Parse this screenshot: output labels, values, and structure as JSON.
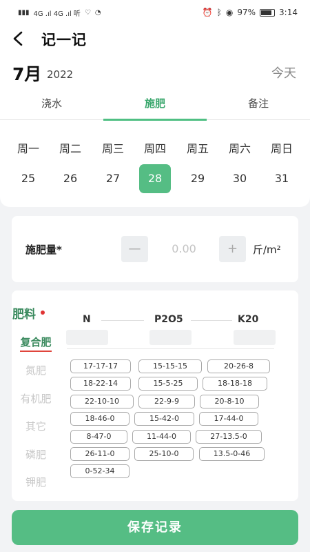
{
  "status_bar": {
    "left_text": "4G .ıl 4G .ıl  听",
    "battery": "97%",
    "time": "3:14"
  },
  "nav": {
    "title": "记一记"
  },
  "date_header": {
    "month": "7月",
    "year": "2022",
    "today": "今天"
  },
  "tabs": [
    {
      "label": "浇水",
      "active": false
    },
    {
      "label": "施肥",
      "active": true
    },
    {
      "label": "备注",
      "active": false
    }
  ],
  "week": [
    {
      "weekday": "周一",
      "day": "25"
    },
    {
      "weekday": "周二",
      "day": "26"
    },
    {
      "weekday": "周三",
      "day": "27"
    },
    {
      "weekday": "周四",
      "day": "28",
      "selected": true
    },
    {
      "weekday": "周五",
      "day": "29"
    },
    {
      "weekday": "周六",
      "day": "30"
    },
    {
      "weekday": "周日",
      "day": "31"
    }
  ],
  "amount": {
    "label": "施肥量*",
    "minus": "—",
    "value": "0.00",
    "plus": "+",
    "unit": "斤/m²"
  },
  "fertilizer": {
    "heading": "肥料",
    "categories": [
      "复合肥",
      "氮肥",
      "有机肥",
      "其它",
      "磷肥",
      "钾肥"
    ],
    "active_category": "复合肥",
    "npk_headers": [
      "N",
      "P2O5",
      "K20"
    ],
    "formulas": [
      "17-17-17",
      "15-15-15",
      "20-26-8",
      "18-22-14",
      "15-5-25",
      "18-18-18",
      "22-10-10",
      "22-9-9",
      "20-8-10",
      "18-46-0",
      "15-42-0",
      "17-44-0",
      "8-47-0",
      "11-44-0",
      "27-13.5-0",
      "26-11-0",
      "25-10-0",
      "13.5-0-46",
      "0-52-34"
    ]
  },
  "save_button": {
    "label": "保存记录"
  },
  "colors": {
    "accent": "#55bd84",
    "accent_dark": "#3a8a5e",
    "alert": "#e03333"
  }
}
